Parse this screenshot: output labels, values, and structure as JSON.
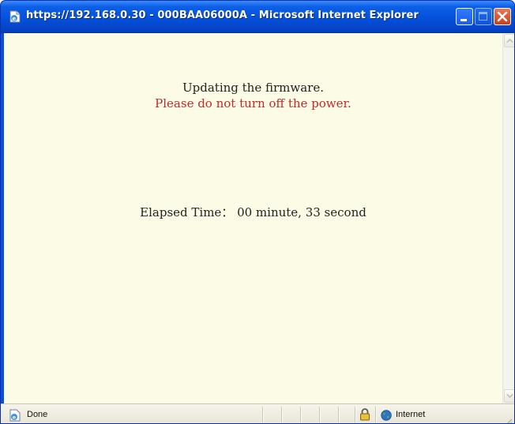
{
  "window": {
    "title": "https://192.168.0.30 - 000BAA06000A - Microsoft Internet Explorer"
  },
  "content": {
    "line1": "Updating the firmware.",
    "line2": "Please do not turn off the power.",
    "elapsed": "Elapsed Time： 00 minute, 33 second"
  },
  "statusbar": {
    "status": "Done",
    "zone": "Internet"
  },
  "colors": {
    "titlebar": "#0350db",
    "page_background": "#fbfbe6",
    "warning_text": "#c12a2a"
  },
  "icons": {
    "title": "ie-page-icon",
    "status": "ie-page-icon",
    "security": "lock-icon",
    "zone": "globe-icon"
  }
}
